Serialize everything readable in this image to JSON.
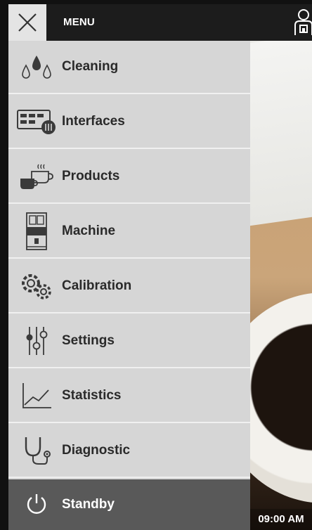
{
  "header": {
    "title": "MENU",
    "close_icon": "close-icon",
    "user_icon": "user-icon"
  },
  "menu": {
    "items": [
      {
        "label": "Cleaning",
        "icon": "water-drops-icon"
      },
      {
        "label": "Interfaces",
        "icon": "interfaces-icon"
      },
      {
        "label": "Products",
        "icon": "coffee-cups-icon"
      },
      {
        "label": "Machine",
        "icon": "coffee-machine-icon"
      },
      {
        "label": "Calibration",
        "icon": "gears-icon"
      },
      {
        "label": "Settings",
        "icon": "sliders-icon"
      },
      {
        "label": "Statistics",
        "icon": "line-chart-icon"
      },
      {
        "label": "Diagnostic",
        "icon": "stethoscope-icon"
      }
    ],
    "standby": {
      "label": "Standby",
      "icon": "power-icon"
    }
  },
  "status": {
    "time": "09:00 AM"
  },
  "colors": {
    "topbar": "#1c1c1c",
    "menu_bg": "#d6d6d6",
    "standby_bg": "#595959",
    "icon_color": "#3a3a3a"
  }
}
